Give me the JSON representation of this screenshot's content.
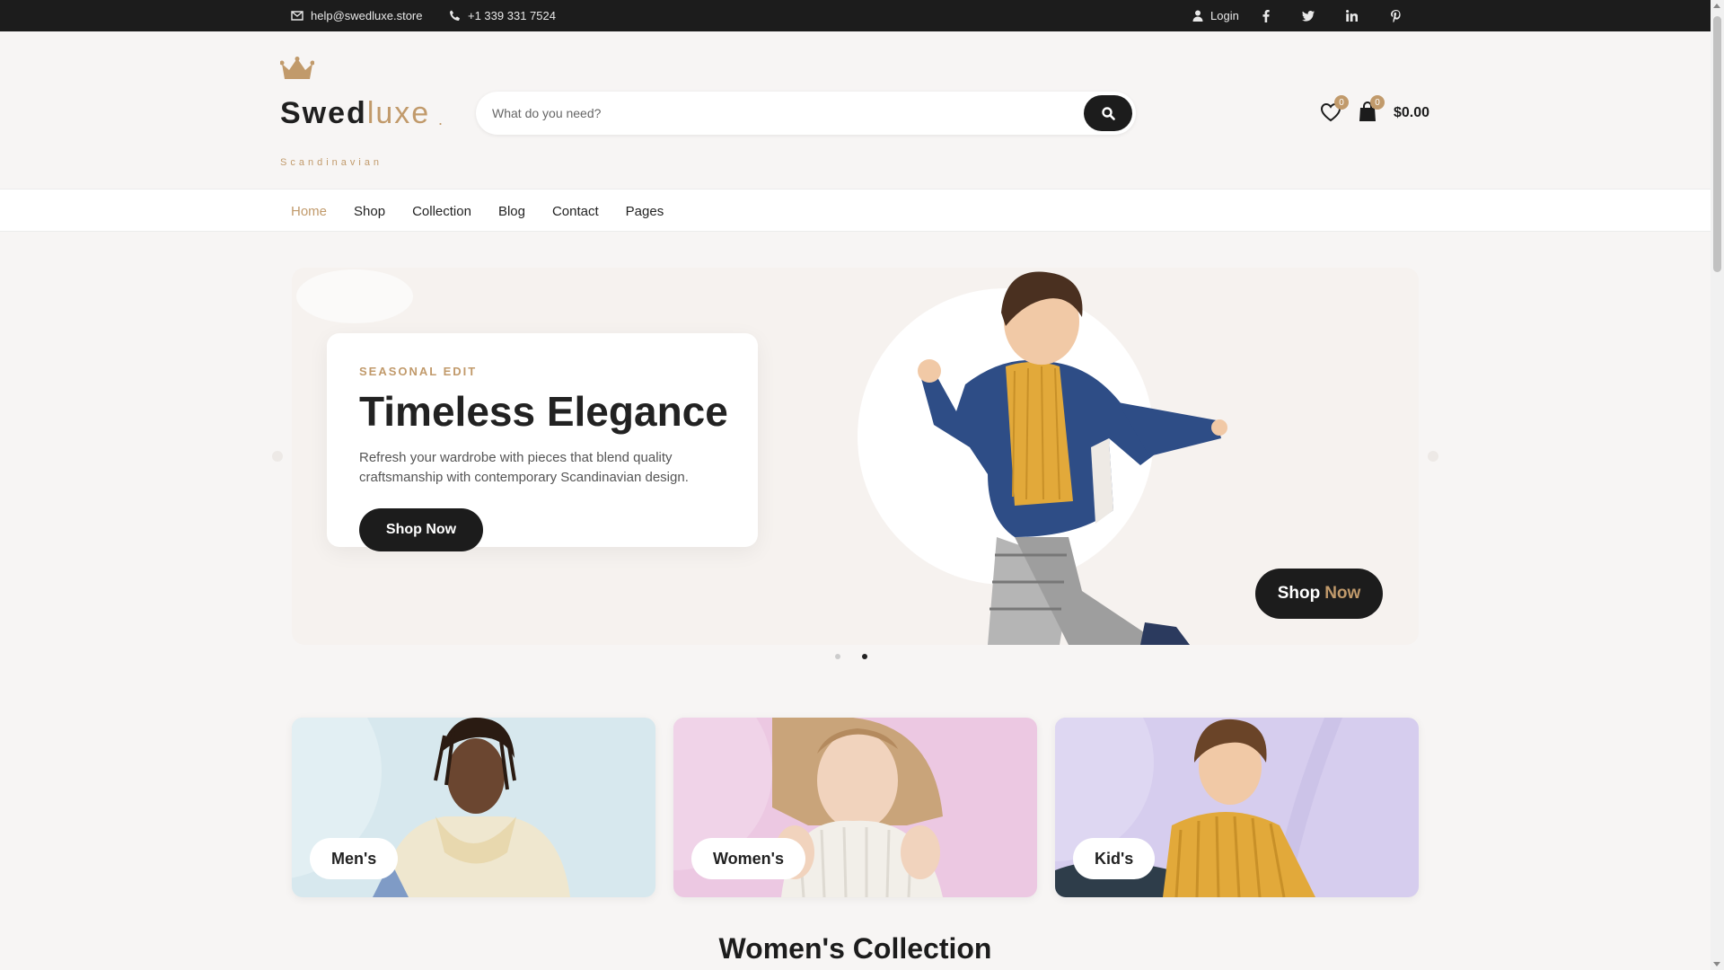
{
  "topbar": {
    "email": "help@swedluxe.store",
    "phone": "+1 339 331 7524",
    "login": "Login",
    "socials": [
      "facebook-icon",
      "twitter-icon",
      "linkedin-icon",
      "pinterest-icon"
    ]
  },
  "header": {
    "logo_main": "Swed",
    "logo_accent": "luxe",
    "logo_dot": ".",
    "tagline": "Scandinavian",
    "search_placeholder": "What do you need?",
    "wishlist_count": "0",
    "cart_count": "0",
    "cart_total": "$0.00"
  },
  "nav": {
    "items": [
      "Home",
      "Shop",
      "Collection",
      "Blog",
      "Contact",
      "Pages"
    ],
    "active": "Home"
  },
  "hero": {
    "eyebrow": "SEASONAL EDIT",
    "title": "Timeless Elegance",
    "description": "Refresh your wardrobe with pieces that blend quality craftsmanship with contemporary Scandinavian design.",
    "cta": "Shop Now",
    "cta2_word1": "Shop",
    "cta2_word2": "Now",
    "slides": 2,
    "active_slide": 2
  },
  "categories": [
    {
      "label": "Men's",
      "color": "#d7e8ee"
    },
    {
      "label": "Women's",
      "color": "#ecc8e2"
    },
    {
      "label": "Kid's",
      "color": "#d6cdee"
    }
  ],
  "section_title": "Women's Collection",
  "colors": {
    "accent": "#c19a6b",
    "dark": "#1c1c1c",
    "bg": "#f7f5f4"
  }
}
